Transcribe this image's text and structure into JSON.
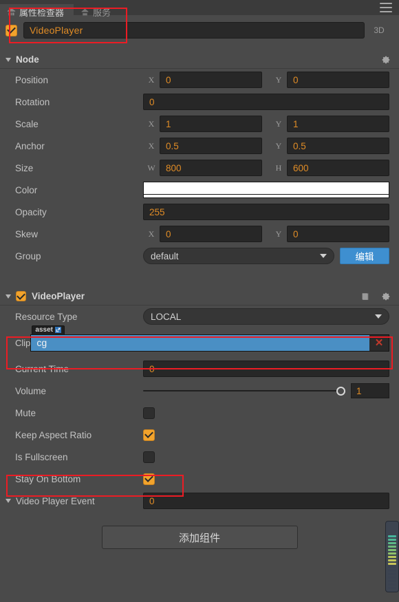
{
  "window": {
    "tabs": [
      {
        "label": "属性检查器",
        "icon": "inspector-icon",
        "active": true
      },
      {
        "label": "服务",
        "icon": "services-icon",
        "active": false
      }
    ],
    "menu_icon": "hamburger-menu-icon"
  },
  "node_name": {
    "enabled_checkbox": "checked",
    "value": "VideoPlayer",
    "mode_badge": "3D"
  },
  "node_section": {
    "title": "Node",
    "expanded": true,
    "gear_icon": "gear-icon",
    "properties": [
      {
        "label": "Position",
        "type": "vec2",
        "axes": [
          "X",
          "Y"
        ],
        "values": [
          "0",
          "0"
        ]
      },
      {
        "label": "Rotation",
        "type": "number",
        "values": [
          "0"
        ]
      },
      {
        "label": "Scale",
        "type": "vec2",
        "axes": [
          "X",
          "Y"
        ],
        "values": [
          "1",
          "1"
        ]
      },
      {
        "label": "Anchor",
        "type": "vec2",
        "axes": [
          "X",
          "Y"
        ],
        "values": [
          "0.5",
          "0.5"
        ]
      },
      {
        "label": "Size",
        "type": "vec2",
        "axes": [
          "W",
          "H"
        ],
        "values": [
          "800",
          "600"
        ]
      },
      {
        "label": "Color",
        "type": "color",
        "values": [
          "#FFFFFF"
        ]
      },
      {
        "label": "Opacity",
        "type": "number",
        "values": [
          "255"
        ]
      },
      {
        "label": "Skew",
        "type": "vec2",
        "axes": [
          "X",
          "Y"
        ],
        "values": [
          "0",
          "0"
        ]
      },
      {
        "label": "Group",
        "type": "dropdown",
        "values": [
          "default"
        ],
        "button": "编辑"
      }
    ]
  },
  "component_section": {
    "title": "VideoPlayer",
    "expanded": true,
    "enabled_checkbox": "checked",
    "help_icon": "book-icon",
    "gear_icon": "gear-icon",
    "resource_type": {
      "label": "Resource Type",
      "value": "LOCAL"
    },
    "clip": {
      "label": "Clip",
      "tag": "asset",
      "tag_icon": "external-link-icon",
      "value": "cg",
      "clear_icon": "✕"
    },
    "current_time": {
      "label": "Current Time",
      "value": "0"
    },
    "volume": {
      "label": "Volume",
      "value": "1",
      "slider_percent": 100
    },
    "toggles": [
      {
        "label": "Mute",
        "checked": false
      },
      {
        "label": "Keep Aspect Ratio",
        "checked": true
      },
      {
        "label": "Is Fullscreen",
        "checked": false
      },
      {
        "label": "Stay On Bottom",
        "checked": true
      }
    ]
  },
  "event_section": {
    "title": "Video Player Event",
    "expanded": true,
    "value": "0"
  },
  "add_component_button": "添加组件",
  "vu_meter": {
    "name": "audio-level-meter",
    "segments": [
      "#3b4250",
      "#3b4250",
      "#3b4250",
      "#3b4250",
      "#3b4250",
      "#3b4250",
      "#3b4250",
      "#c8c45a",
      "#c0c457",
      "#b6c45a",
      "#8fc06a",
      "#7dbd72",
      "#6dba7a",
      "#5cb887",
      "#4fb694",
      "#46b49c"
    ]
  },
  "colors": {
    "accent_orange": "#e08c26",
    "checkbox_orange": "#f2a32c",
    "blue_button": "#3e8fd0",
    "asset_blue": "#4a8fc4",
    "highlight_red": "#ec1c24",
    "panel_bg": "#4a4a4a"
  }
}
